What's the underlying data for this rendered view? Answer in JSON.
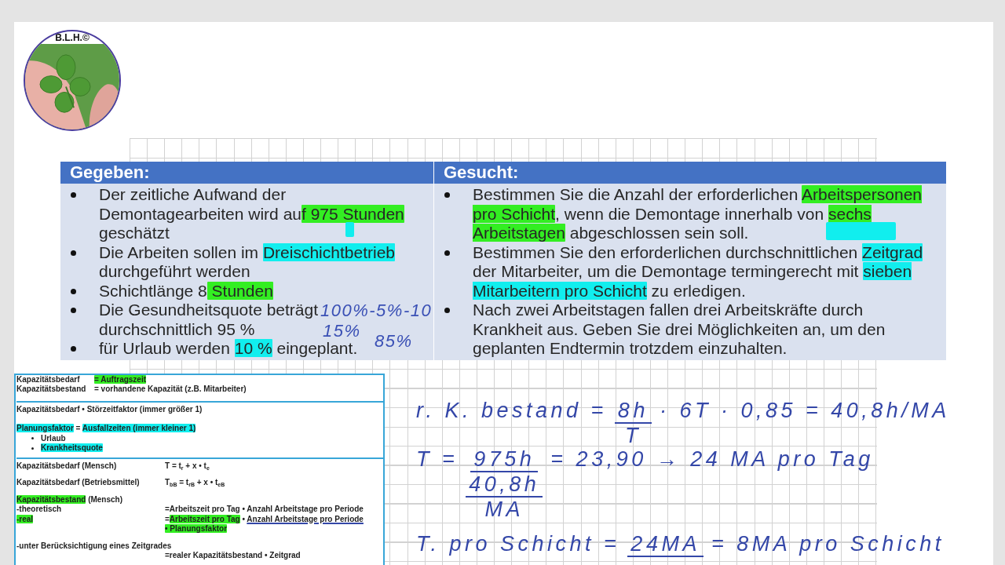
{
  "logo": {
    "text": "B.L.H.©"
  },
  "task_table": {
    "columns": [
      {
        "heading": "Gegeben:",
        "items": [
          {
            "segments": [
              {
                "text": "Der zeitliche Aufwand der Demontagearbeiten wird au"
              },
              {
                "text": "f 975 Stunden",
                "color": "#33ee22"
              },
              {
                "text": " geschätzt"
              }
            ]
          },
          {
            "segments": [
              {
                "text": "Die Arbeiten sollen im "
              },
              {
                "text": "Dreischichtbetrieb",
                "color": "#11eeee"
              },
              {
                "text": " durchgeführt werden"
              }
            ]
          },
          {
            "segments": [
              {
                "text": "Schichtlänge 8"
              },
              {
                "text": " Stunden",
                "color": "#33ee22"
              }
            ]
          },
          {
            "segments": [
              {
                "text": "Die Gesundheitsquote beträgt durchschnittlich 95 %"
              }
            ]
          },
          {
            "segments": [
              {
                "text": "für Urlaub werden "
              },
              {
                "text": "10 %",
                "color": "#11eeee"
              },
              {
                "text": " eingeplant."
              }
            ]
          }
        ],
        "ink_notes": [
          {
            "text": "100%-5%-10"
          },
          {
            "text": "15%"
          },
          {
            "text": "85%"
          }
        ]
      },
      {
        "heading": "Gesucht:",
        "items": [
          {
            "segments": [
              {
                "text": "Bestimmen Sie die Anzahl der erforderlichen "
              },
              {
                "text": "Arbeitspersonen pro Schicht",
                "color": "#33ee22"
              },
              {
                "text": ", wenn die Demontage innerhalb von "
              },
              {
                "text": "sechs Arbeitstagen",
                "color": "#33ee22"
              },
              {
                "text": " abgeschlossen sein soll."
              }
            ]
          },
          {
            "segments": [
              {
                "text": "Bestimmen Sie den erforderlichen durchschnittlichen "
              },
              {
                "text": "Zeitgrad",
                "color": "#11eeee"
              },
              {
                "text": " der Mitarbeiter, um die Demontage termingerecht mit "
              },
              {
                "text": "sieben Mitarbeitern pro Schicht",
                "color": "#11eeee"
              },
              {
                "text": " zu erledigen."
              }
            ]
          },
          {
            "segments": [
              {
                "text": "Nach zwei Arbeitstagen fallen drei Arbeitskräfte durch Krankheit aus. Geben Sie drei Möglichkeiten an, um den geplanten Endtermin trotzdem einzuhalten."
              }
            ]
          }
        ]
      }
    ]
  },
  "formula_box": {
    "sections": [
      {
        "kind": "definitions",
        "lines": [
          {
            "kind": "row",
            "label": [
              {
                "text": "Kapazitätsbedarf"
              }
            ],
            "value": [
              {
                "text": "= Auftragszeit",
                "color": "#33ee22"
              }
            ]
          },
          {
            "kind": "row",
            "label": [
              {
                "text": "Kapazitätsbestand"
              }
            ],
            "value": [
              {
                "text": "= vorhandene Kapazität (z.B. Mitarbeiter)"
              }
            ]
          }
        ]
      },
      {
        "kind": "factors",
        "lines": [
          {
            "kind": "row",
            "label": [
              {
                "text": "Kapazitätsbedarf • Störzeitfaktor (immer größer 1)"
              }
            ]
          },
          {
            "kind": "spaced",
            "label": [
              {
                "text": "Planungsfaktor",
                "color": "#11eeee"
              },
              {
                "text": " = "
              },
              {
                "text": "Ausfallzeiten (immer kleiner 1)",
                "color": "#11eeee"
              }
            ]
          },
          {
            "kind": "bullet",
            "label": [
              {
                "text": "Urlaub"
              }
            ]
          },
          {
            "kind": "bullet",
            "label": [
              {
                "text": "Krankheitsquote",
                "color": "#11eeee"
              }
            ]
          }
        ]
      },
      {
        "kind": "formulas",
        "lines": [
          {
            "kind": "row",
            "label": [
              {
                "text": "Kapazitätsbedarf (Mensch)"
              }
            ],
            "value": [
              {
                "text": "T = t$_{r}$ + x • t$_{e}$"
              }
            ]
          },
          {
            "kind": "spaced",
            "label": [
              {
                "text": "Kapazitätsbedarf (Betriebsmittel)"
              }
            ],
            "value": [
              {
                "text": "T$_{bB}$ = t$_{rB}$ + x • t$_{eB}$"
              }
            ]
          },
          {
            "kind": "spaced",
            "label": [
              {
                "text": "Kapazitätsbestand",
                "color": "#33ee22"
              },
              {
                "text": " (Mensch)"
              }
            ]
          },
          {
            "kind": "row",
            "label": [
              {
                "text": "-theoretisch"
              }
            ],
            "value": [
              {
                "text": "=Arbeitszeit pro Tag • Anzahl Arbeitstage pro Periode"
              }
            ]
          },
          {
            "kind": "row",
            "label": [
              {
                "text": "-real",
                "color": "#33ee22"
              }
            ],
            "value": [
              {
                "text": "="
              },
              {
                "text": "Arbeitszeit pro Tag",
                "color": "#33ee22"
              },
              {
                "text": " • "
              },
              {
                "text": "Anzahl Arbeitstage pro Periode",
                "underlined": true
              }
            ]
          },
          {
            "kind": "row",
            "value": [
              {
                "text": "• Planungsfaktor",
                "color": "#33ee22"
              }
            ]
          },
          {
            "kind": "spaced",
            "label": [
              {
                "text": "-unter Berücksichtigung eines Zeitgrades"
              }
            ]
          },
          {
            "kind": "row",
            "value": [
              {
                "text": "=realer Kapazitätsbestand • Zeitgrad"
              }
            ]
          }
        ]
      }
    ]
  },
  "handwritten_notes": [
    {
      "parts": [
        {
          "kind": "text",
          "text": "r. K. bestand ="
        },
        {
          "kind": "fraction",
          "numerator": "8h",
          "denominator": "T"
        },
        {
          "kind": "text",
          "text": "· 6T · 0,85 = 40,8h/MA"
        }
      ]
    },
    {
      "parts": [
        {
          "kind": "text",
          "text": "T ="
        },
        {
          "kind": "fraction",
          "numerator": "975h",
          "denominator": {
            "numerator": "40,8h",
            "denominator": "MA"
          }
        },
        {
          "kind": "text",
          "text": "= 23,90 → 24 MA pro Tag"
        }
      ]
    },
    {
      "parts": [
        {
          "kind": "text",
          "text": "T. pro Schicht ="
        },
        {
          "kind": "fraction",
          "numerator": "24MA"
        },
        {
          "kind": "text",
          "text": "= 8MA pro Schicht"
        }
      ]
    }
  ]
}
